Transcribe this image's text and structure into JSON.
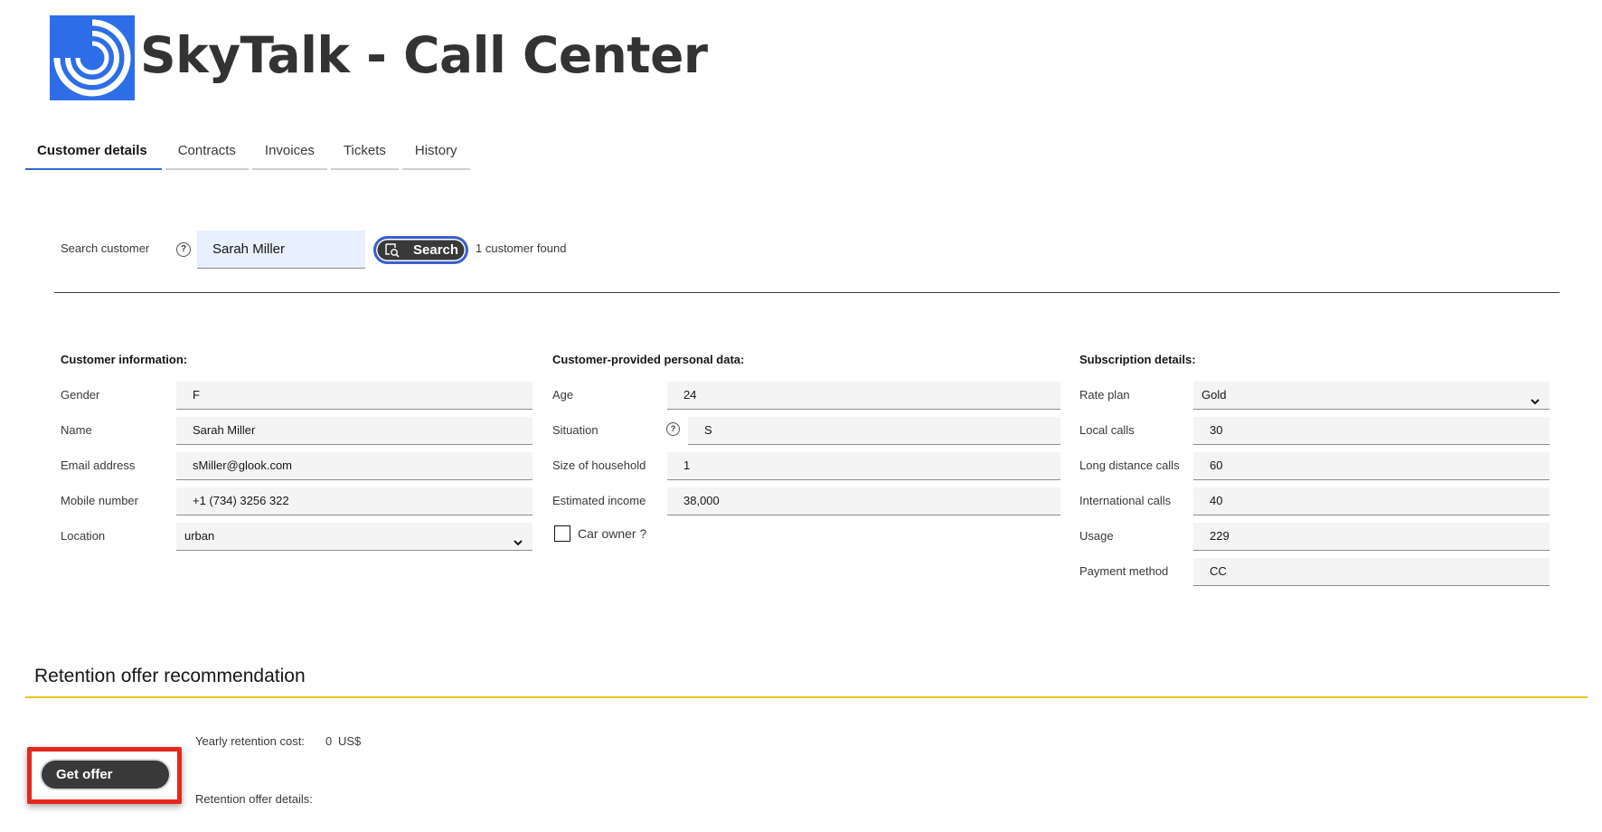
{
  "app": {
    "title": "SkyTalk - Call Center",
    "logo_icon": "concentric-arcs-logo",
    "brand_color": "#2d6ee8"
  },
  "tabs": [
    {
      "label": "Customer details",
      "active": true
    },
    {
      "label": "Contracts",
      "active": false
    },
    {
      "label": "Invoices",
      "active": false
    },
    {
      "label": "Tickets",
      "active": false
    },
    {
      "label": "History",
      "active": false
    }
  ],
  "search": {
    "label": "Search customer",
    "help_icon": "question-circle-icon",
    "value": "Sarah Miller",
    "button_label": "Search",
    "button_icon": "search-icon",
    "result_text": "1 customer found"
  },
  "customer_info": {
    "title": "Customer information:",
    "fields": [
      {
        "label": "Gender",
        "value": "F"
      },
      {
        "label": "Name",
        "value": "Sarah Miller"
      },
      {
        "label": "Email address",
        "value": "sMiller@glook.com"
      },
      {
        "label": "Mobile number",
        "value": "+1 (734) 3256 322"
      },
      {
        "label": "Location",
        "value": "urban"
      }
    ]
  },
  "personal_data": {
    "title": "Customer-provided personal data:",
    "fields": [
      {
        "label": "Age",
        "value": "24"
      },
      {
        "label": "Situation",
        "value": "S"
      },
      {
        "label": "Size of household",
        "value": "1"
      },
      {
        "label": "Estimated income",
        "value": "38,000"
      }
    ],
    "car_owner_label": "Car owner ?",
    "car_owner_checked": false
  },
  "subscription": {
    "title": "Subscription details:",
    "fields": [
      {
        "label": "Rate plan",
        "value": "Gold"
      },
      {
        "label": "Local calls",
        "value": "30"
      },
      {
        "label": "Long distance calls",
        "value": "60"
      },
      {
        "label": "International calls",
        "value": "40"
      },
      {
        "label": "Usage",
        "value": "229"
      },
      {
        "label": "Payment method",
        "value": "CC"
      }
    ]
  },
  "retention": {
    "title": "Retention offer recommendation",
    "get_offer_label": "Get offer",
    "cost_label": "Yearly retention cost:",
    "cost_value": "0",
    "cost_unit": "US$",
    "details_label": "Retention offer details:",
    "accent_color": "#f1c21b",
    "highlight_color": "#e6271c"
  }
}
